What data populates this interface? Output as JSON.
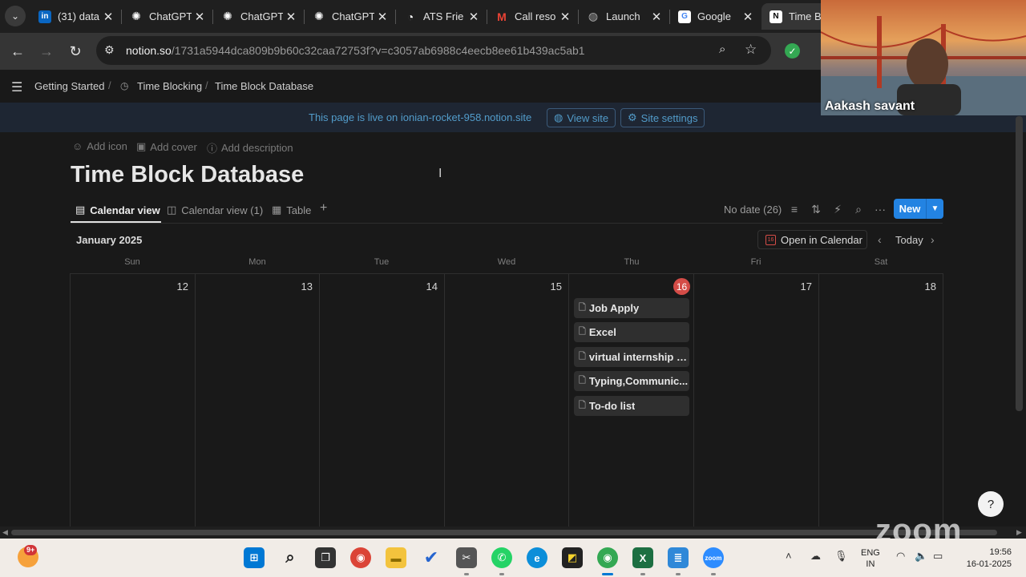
{
  "browser": {
    "tabs": [
      {
        "title": "(31) data",
        "favicon": "linkedin-icon",
        "color": "#0a66c2"
      },
      {
        "title": "ChatGPT",
        "favicon": "chatgpt-icon",
        "color": "#ffffff"
      },
      {
        "title": "ChatGPT",
        "favicon": "chatgpt-icon",
        "color": "#ffffff"
      },
      {
        "title": "ChatGPT",
        "favicon": "chatgpt-icon",
        "color": "#ffffff"
      },
      {
        "title": "ATS Frie",
        "favicon": "ats-icon",
        "color": "#ffffff"
      },
      {
        "title": "Call reso",
        "favicon": "gmail-icon",
        "color": "#ea4335"
      },
      {
        "title": "Launch",
        "favicon": "globe-icon",
        "color": "#aaaaaa"
      },
      {
        "title": "Google",
        "favicon": "google-icon",
        "color": "#4285f4"
      },
      {
        "title": "Time Bl",
        "favicon": "notion-icon",
        "color": "#ffffff",
        "active": true
      }
    ],
    "url_host": "notion.so",
    "url_path": "/1731a5944dca809b9b60c32caa72753f?v=c3057ab6988c4eecb8ee61b439ac5ab1"
  },
  "notion": {
    "breadcrumbs": [
      "Getting Started",
      "Time Blocking",
      "Time Block Database"
    ],
    "banner": {
      "text": "This page is live on ionian-rocket-958.notion.site",
      "view_site": "View site",
      "site_settings": "Site settings"
    },
    "meta": {
      "add_icon": "Add icon",
      "add_cover": "Add cover",
      "add_description": "Add description"
    },
    "title": "Time Block Database",
    "views": [
      "Calendar view",
      "Calendar view (1)",
      "Table"
    ],
    "no_date": "No date (26)",
    "new_label": "New",
    "calendar": {
      "month": "January 2025",
      "open_in_calendar": "Open in Calendar",
      "today_label": "Today",
      "today_icon_num": "16",
      "weekdays": [
        "Sun",
        "Mon",
        "Tue",
        "Wed",
        "Thu",
        "Fri",
        "Sat"
      ],
      "days": [
        "12",
        "13",
        "14",
        "15",
        "16",
        "17",
        "18"
      ],
      "events": [
        "Job Apply",
        "Excel",
        "virtual internship a...",
        "Typing,Communic...",
        "To-do list"
      ]
    }
  },
  "zoom": {
    "participant_name": "Aakash savant",
    "watermark": "zoom"
  },
  "taskbar": {
    "weather_badge": "9+",
    "lang_top": "ENG",
    "lang_bottom": "IN",
    "time": "19:56",
    "date": "16-01-2025"
  },
  "colors": {
    "accent": "#2383e2",
    "today": "#d44c47",
    "banner_text": "#529cca"
  }
}
